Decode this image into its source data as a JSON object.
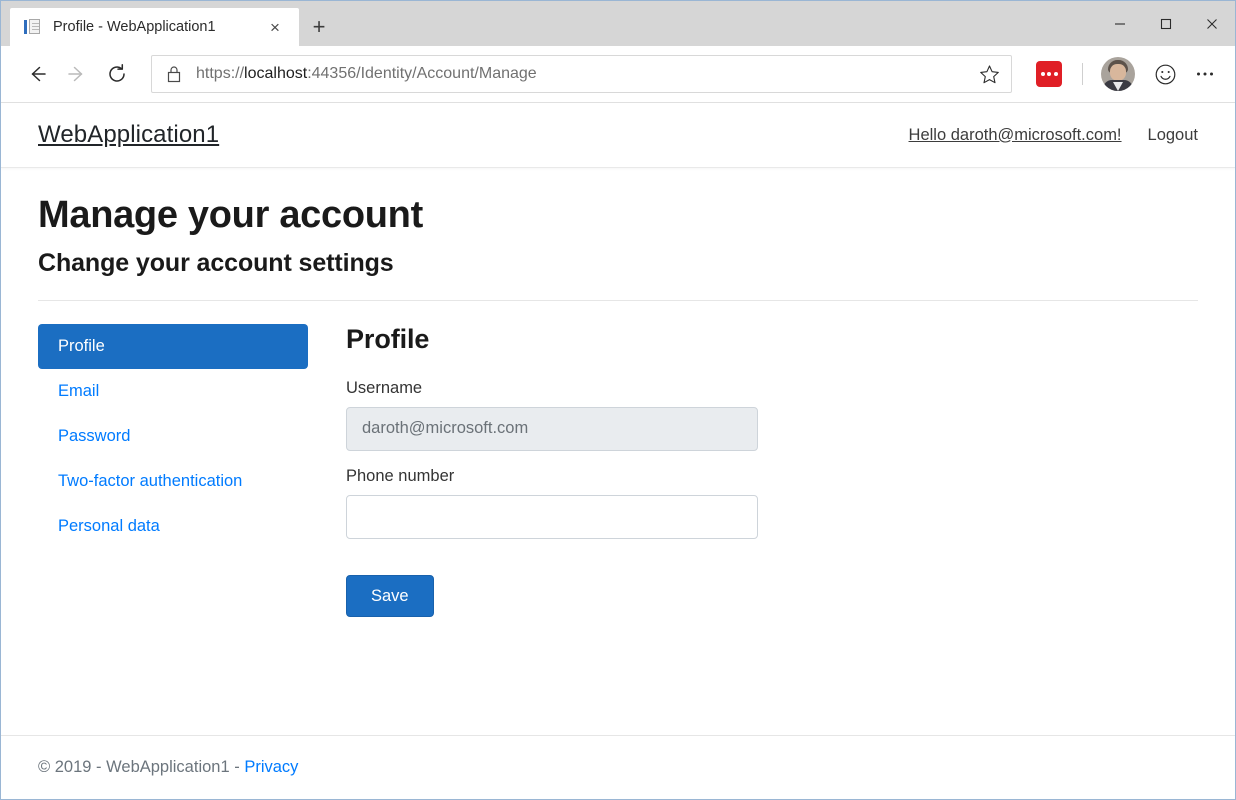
{
  "browser": {
    "tab": {
      "title": "Profile - WebApplication1",
      "favicon": "document-icon",
      "close_label": "×"
    },
    "new_tab_label": "+",
    "window_controls": {
      "minimize": "minimize-icon",
      "maximize": "maximize-icon",
      "close": "close-icon"
    },
    "toolbar": {
      "back": "back-arrow-icon",
      "forward": "forward-arrow-icon",
      "refresh": "refresh-icon",
      "lock": "lock-icon",
      "url_scheme": "https://",
      "url_host": "localhost",
      "url_path": ":44356/Identity/Account/Manage",
      "url_full": "https://localhost:44356/Identity/Account/Manage",
      "favorites": "star-icon",
      "extension": "extension-dots-icon",
      "profile": "user-avatar",
      "feedback": "smiley-icon",
      "settings": "more-options-icon"
    }
  },
  "site": {
    "brand": "WebApplication1",
    "greeting": "Hello daroth@microsoft.com!",
    "logout_label": "Logout"
  },
  "page": {
    "heading": "Manage your account",
    "subheading": "Change your account settings"
  },
  "sidenav": {
    "items": [
      {
        "label": "Profile",
        "active": true
      },
      {
        "label": "Email",
        "active": false
      },
      {
        "label": "Password",
        "active": false
      },
      {
        "label": "Two-factor authentication",
        "active": false
      },
      {
        "label": "Personal data",
        "active": false
      }
    ]
  },
  "form": {
    "title": "Profile",
    "username_label": "Username",
    "username_value": "daroth@microsoft.com",
    "phone_label": "Phone number",
    "phone_value": "",
    "phone_placeholder": "",
    "save_label": "Save"
  },
  "footer": {
    "copyright": "© 2019 - WebApplication1 - ",
    "privacy_label": "Privacy"
  },
  "colors": {
    "primary": "#1b6ec2",
    "link": "#007bff",
    "extension_red": "#e01f26",
    "disabled_bg": "#e9ecef"
  }
}
